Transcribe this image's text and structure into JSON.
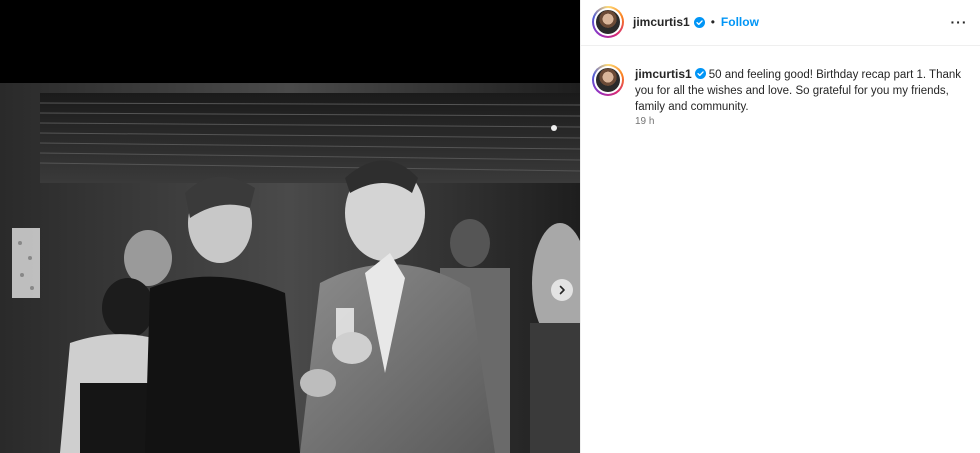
{
  "post": {
    "username": "jimcurtis1",
    "follow_label": "Follow",
    "separator": "•",
    "more_label": "···",
    "caption": "50 and feeling good! Birthday recap part 1. Thank you for all the wishes and love. So grateful for you my friends, family and community.",
    "timestamp": "19 h"
  },
  "colors": {
    "accent": "#0095f6",
    "verified": "#0095f6",
    "text": "#262626",
    "muted": "#737373"
  },
  "icons": {
    "verified": "verified-badge-icon",
    "next": "chevron-right-icon",
    "more": "more-options-icon"
  }
}
